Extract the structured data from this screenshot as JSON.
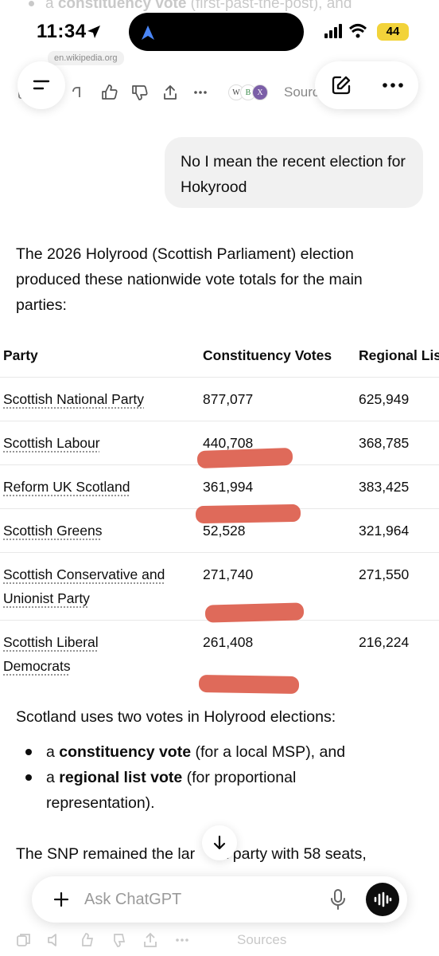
{
  "top_faded": {
    "line1_prefix": "a ",
    "line1_bold": "constituency vote",
    "line1_suffix": " (first-past-the-post), and"
  },
  "status_bar": {
    "time": "11:34",
    "battery": "44"
  },
  "source_chip": "en.wikipedia.org",
  "message_actions_top": {
    "sources_label": "Sources",
    "badges": [
      "W",
      "B",
      "X"
    ]
  },
  "user_message": "No I mean the recent election for Hokyrood",
  "assistant": {
    "intro": "The 2026 Holyrood (Scottish Parliament) election produced these nationwide vote totals for the main parties:",
    "table": {
      "headers": [
        "Party",
        "Constituency Votes",
        "Regional Lis"
      ],
      "rows": [
        {
          "party": "Scottish National Party",
          "constituency": "877,077",
          "regional": "625,949"
        },
        {
          "party": "Scottish Labour",
          "constituency": "440,708",
          "regional": "368,785"
        },
        {
          "party": "Reform UK Scotland",
          "constituency": "361,994",
          "regional": "383,425"
        },
        {
          "party": "Scottish Greens",
          "constituency": "52,528",
          "regional": "321,964"
        },
        {
          "party_line1": "Scottish Conservative and",
          "party_line2": "Unionist Party",
          "constituency": "271,740",
          "regional": "271,550"
        },
        {
          "party_line1": "Scottish Liberal",
          "party_line2": "Democrats",
          "constituency": "261,408",
          "regional": "216,224"
        }
      ]
    },
    "votes_intro": "Scotland uses two votes in Holyrood elections:",
    "bullets": [
      {
        "prefix": "a ",
        "bold": "constituency vote",
        "suffix": " (for a local MSP), and"
      },
      {
        "prefix": "a ",
        "bold": "regional list vote",
        "suffix": " (for proportional representation)."
      }
    ],
    "snp_line": "The SNP remained the lar     st party with 58 seats,"
  },
  "composer": {
    "placeholder": "Ask ChatGPT"
  },
  "message_actions_bottom": {
    "sources_label": "Sources"
  },
  "colors": {
    "accent": "#0d0d0d",
    "scribble": "#dc5a48",
    "battery": "#f2d33a",
    "bubble": "#f1f1f1"
  }
}
